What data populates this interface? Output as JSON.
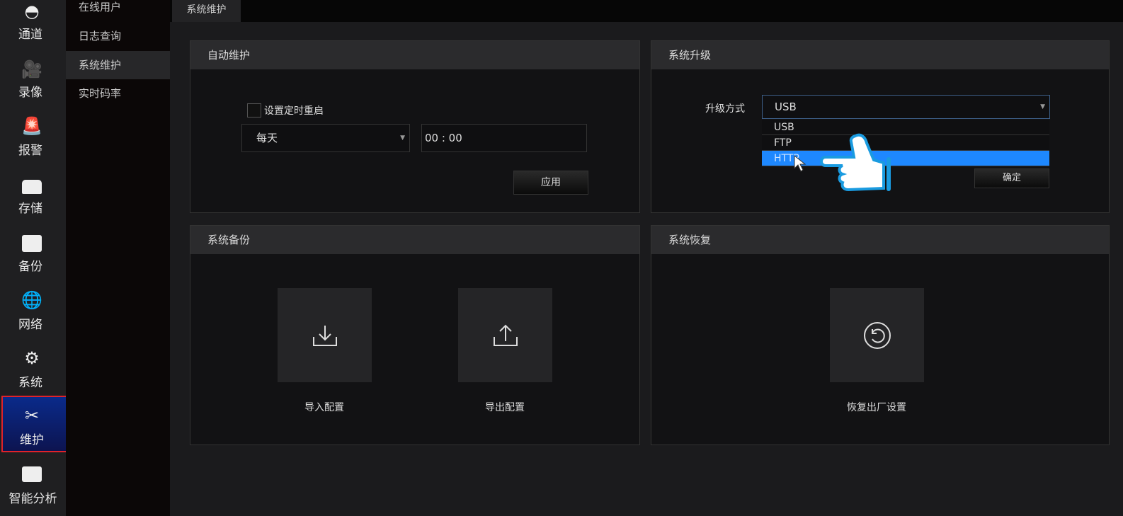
{
  "nav": [
    {
      "label": "通道",
      "icon": "camera-dome-icon"
    },
    {
      "label": "录像",
      "icon": "video-camera-icon"
    },
    {
      "label": "报警",
      "icon": "alarm-light-icon"
    },
    {
      "label": "存储",
      "icon": "hard-drive-icon"
    },
    {
      "label": "备份",
      "icon": "backup-box-icon"
    },
    {
      "label": "网络",
      "icon": "globe-icon"
    },
    {
      "label": "系统",
      "icon": "gear-icon"
    },
    {
      "label": "维护",
      "icon": "tools-icon",
      "active": true
    },
    {
      "label": "智能分析",
      "icon": "robot-icon"
    }
  ],
  "submenu": [
    "在线用户",
    "日志查询",
    "系统维护",
    "实时码率"
  ],
  "tab": "系统维护",
  "auto": {
    "title": "自动维护",
    "checkbox_label": "设置定时重启",
    "checked": false,
    "frequency": "每天",
    "time": "00 : 00",
    "apply": "应用"
  },
  "upgrade": {
    "title": "系统升级",
    "label": "升级方式",
    "value": "USB",
    "options": [
      "USB",
      "FTP",
      "HTTP"
    ],
    "highlighted": "HTTP",
    "confirm": "确定"
  },
  "backup": {
    "title": "系统备份",
    "import": "导入配置",
    "export": "导出配置"
  },
  "restore": {
    "title": "系统恢复",
    "factory": "恢复出厂设置"
  },
  "colors": {
    "accent": "#1e88ff",
    "active_border": "#e0222a"
  }
}
